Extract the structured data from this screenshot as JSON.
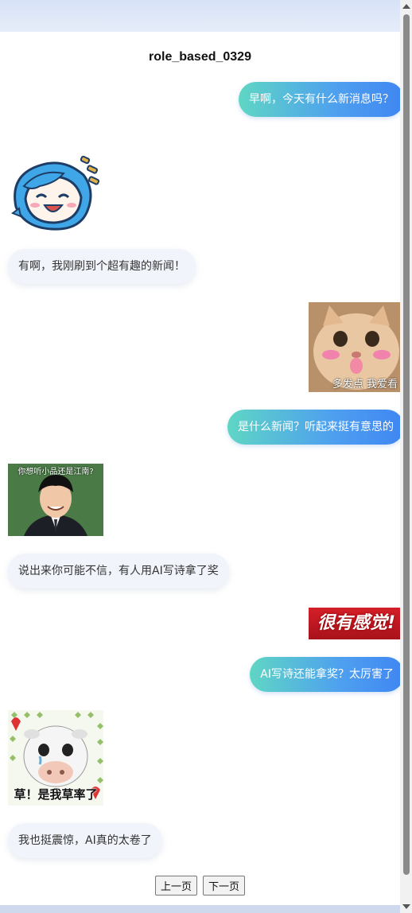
{
  "chat": {
    "title": "role_based_0329",
    "messages": [
      {
        "role": "user",
        "text": "早啊，今天有什么新消息吗？"
      },
      {
        "role": "bot",
        "sticker": "anime-girl-laughing-sticker"
      },
      {
        "role": "bot",
        "text": "有啊，我刚刷到个超有趣的新闻！"
      },
      {
        "role": "user",
        "sticker": "cat-sticker",
        "caption": "多发点 我爱看"
      },
      {
        "role": "user",
        "text": "是什么新闻？听起来挺有意思的"
      },
      {
        "role": "bot",
        "sticker": "man-suit-sticker",
        "caption": "你想听小品还是江南?"
      },
      {
        "role": "bot",
        "text": "说出来你可能不信，有人用AI写诗拿了奖"
      },
      {
        "role": "user",
        "sticker": "banner-sticker",
        "caption": "很有感觉!"
      },
      {
        "role": "user",
        "text": "AI写诗还能拿奖？太厉害了"
      },
      {
        "role": "bot",
        "sticker": "cow-sticker",
        "caption": "草！是我草率了"
      },
      {
        "role": "bot",
        "text": "我也挺震惊，AI真的太卷了"
      }
    ]
  },
  "pager": {
    "prev": "上一页",
    "next": "下一页"
  },
  "colors": {
    "user_gradient_start": "#5fd6c4",
    "user_gradient_end": "#3f86f2",
    "bot_bubble": "#f1f4fa"
  }
}
